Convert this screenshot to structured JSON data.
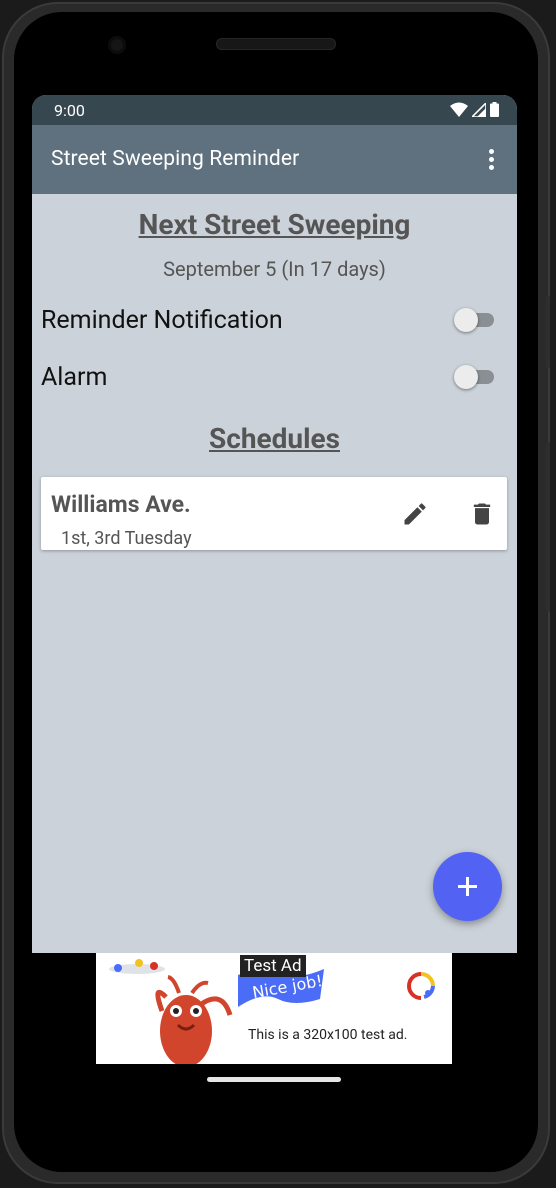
{
  "status_bar": {
    "time": "9:00"
  },
  "app_bar": {
    "title": "Street Sweeping Reminder",
    "menu_icon": "more-vert-icon"
  },
  "next": {
    "heading": "Next Street Sweeping",
    "date_text": "September 5 (In 17 days)"
  },
  "settings": [
    {
      "label": "Reminder Notification",
      "enabled": false
    },
    {
      "label": "Alarm",
      "enabled": false
    }
  ],
  "schedules": {
    "heading": "Schedules",
    "items": [
      {
        "street": "Williams Ave.",
        "days": "1st, 3rd Tuesday",
        "edit_icon": "pencil-icon",
        "delete_icon": "trash-icon"
      }
    ]
  },
  "fab": {
    "icon": "plus-icon"
  },
  "ad": {
    "label": "Test Ad",
    "banner_text": "Nice job!",
    "body": "This is a 320x100 test ad."
  },
  "colors": {
    "status_bar": "#37474f",
    "app_bar": "#5f717e",
    "background": "#cbd2d9",
    "fab": "#5263f4"
  }
}
